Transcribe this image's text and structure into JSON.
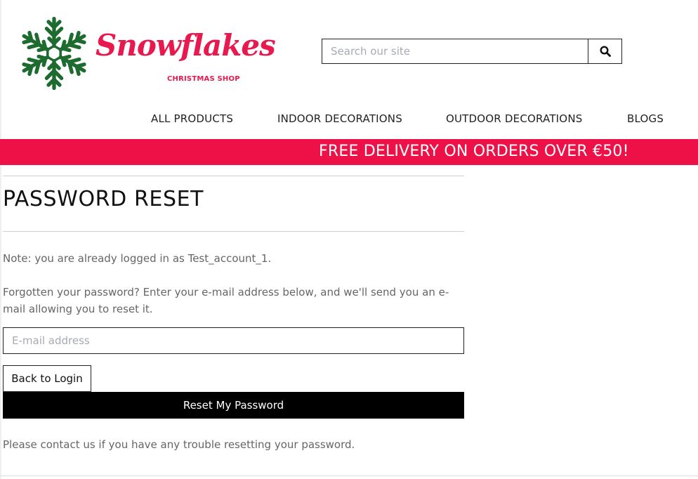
{
  "colors": {
    "brand_red": "#ee1148",
    "logo_green": "#1d6b2f",
    "button_black": "#000000"
  },
  "header": {
    "logo": {
      "icon": "snowflake-icon",
      "title": "Snowflakes",
      "subtitle": "CHRISTMAS SHOP"
    },
    "search": {
      "placeholder": "Search our site",
      "value": "",
      "button_icon": "search-icon"
    }
  },
  "nav": {
    "items": [
      {
        "label": "ALL PRODUCTS"
      },
      {
        "label": "INDOOR DECORATIONS"
      },
      {
        "label": "OUTDOOR DECORATIONS"
      },
      {
        "label": "BLOGS"
      }
    ]
  },
  "banner": {
    "text": "FREE DELIVERY ON ORDERS OVER €50!"
  },
  "main": {
    "title": "PASSWORD RESET",
    "note": "Note: you are already logged in as Test_account_1.",
    "instructions": "Forgotten your password? Enter your e-mail address below, and we'll send you an e-mail allowing you to reset it.",
    "email": {
      "placeholder": "E-mail address",
      "value": ""
    },
    "back_label": "Back to Login",
    "reset_label": "Reset My Password",
    "help": "Please contact us if you have any trouble resetting your password."
  }
}
